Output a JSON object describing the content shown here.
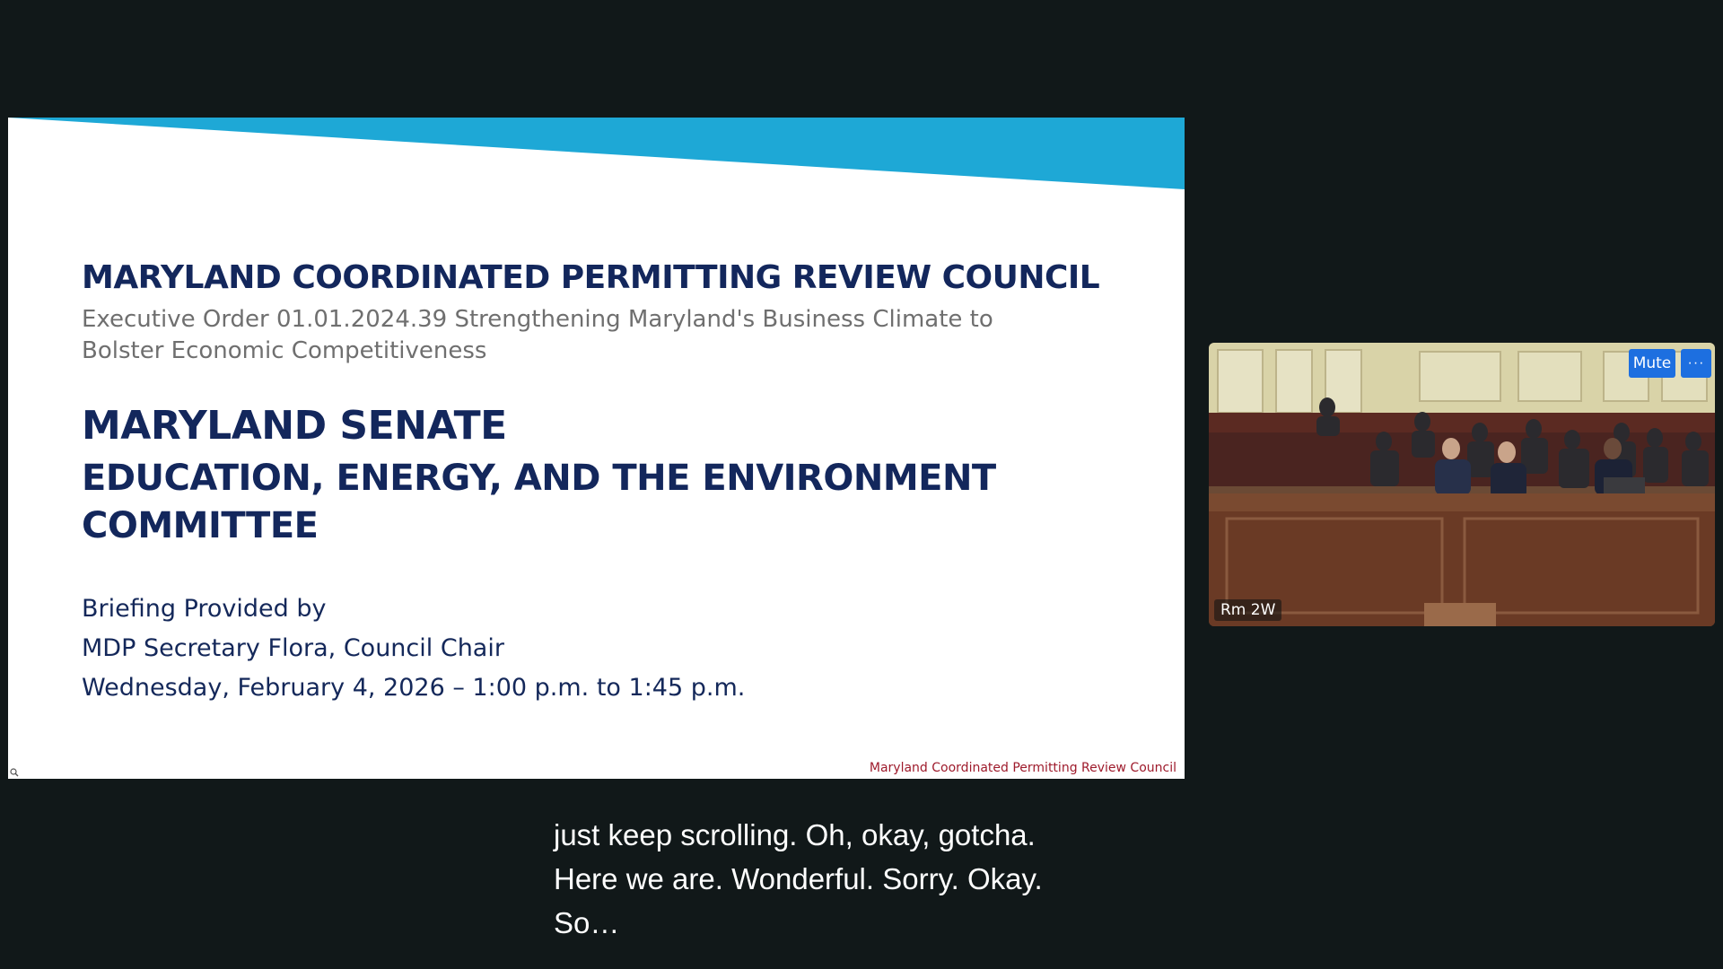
{
  "slide": {
    "council_title": "MARYLAND COORDINATED PERMITTING REVIEW COUNCIL",
    "exec_order_line1": "Executive Order 01.01.2024.39 Strengthening Maryland's Business Climate to",
    "exec_order_line2": "Bolster Economic Competitiveness",
    "senate_title": "MARYLAND SENATE",
    "committee_line1": "EDUCATION, ENERGY, AND THE ENVIRONMENT",
    "committee_line2": "COMMITTEE",
    "briefing_label": "Briefing Provided by",
    "presenter": "MDP Secretary Flora, Council Chair",
    "date_time": "Wednesday, February 4, 2026 – 1:00 p.m. to 1:45 p.m.",
    "footer": "Maryland Coordinated Permitting Review Council",
    "colors": {
      "banner": "#1ea8d6",
      "title_navy": "#13275c",
      "footer_red": "#9e1b2c"
    }
  },
  "video": {
    "mute_label": "Mute",
    "more_label": "···",
    "room_label": "Rm 2W"
  },
  "captions": {
    "lines": [
      "just keep scrolling. Oh, okay, gotcha.",
      "Here we are. Wonderful. Sorry. Okay.",
      "So…"
    ]
  }
}
